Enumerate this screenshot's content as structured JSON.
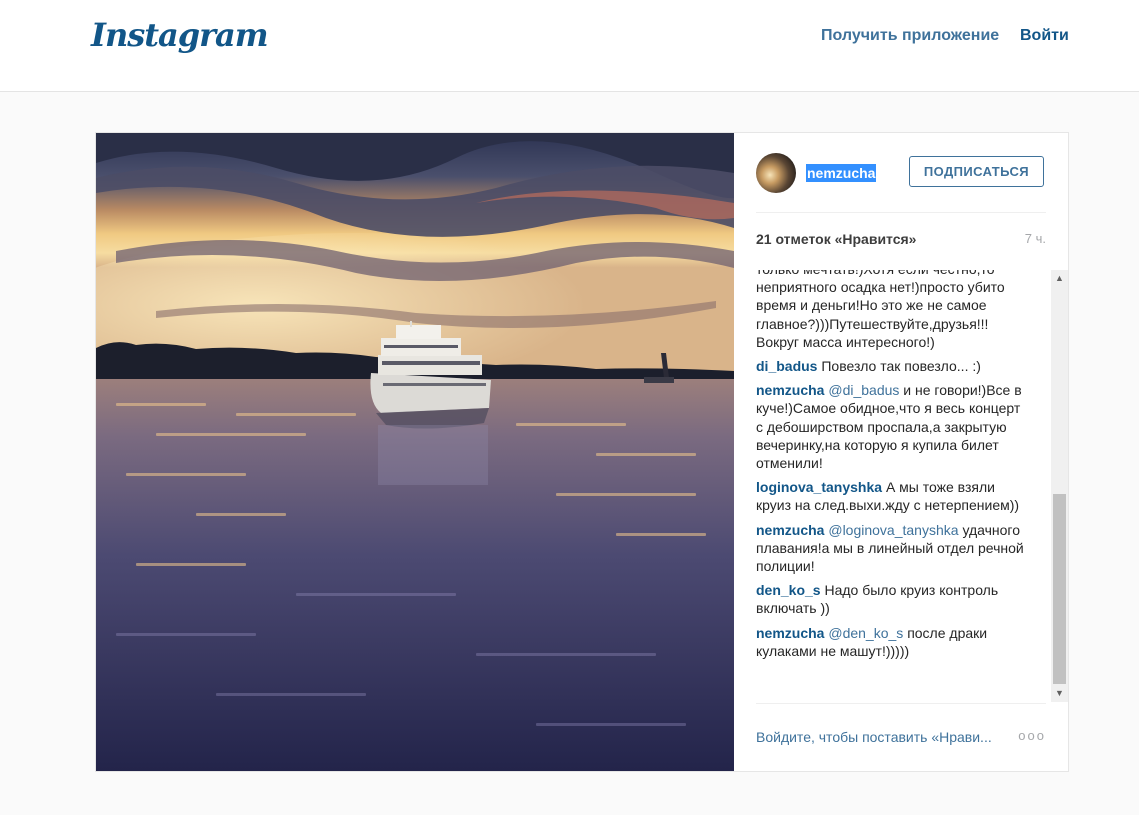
{
  "header": {
    "logo_text": "Instagram",
    "get_app_label": "Получить приложение",
    "login_label": "Войти"
  },
  "post": {
    "author": "nemzucha",
    "follow_label": "ПОДПИСАТЬСЯ",
    "likes_text": "21 отметок «Нравится»",
    "time_ago": "7 ч.",
    "caption_tail": "только мечтать!)Хотя если честно,то неприятного осадка нет!)просто убито время и деньги!Но это же не самое главное?)))Путешествуйте,друзья!!! Вокруг масса интересного!)",
    "comments": [
      {
        "user": "di_badus",
        "mention": "",
        "text": "Повезло так повезло... :)"
      },
      {
        "user": "nemzucha",
        "mention": "@di_badus",
        "text": "и не говори!)Все в куче!)Самое обидное,что я весь концерт с дебоширством проспала,а закрытую вечеринку,на которую я купила билет отменили!"
      },
      {
        "user": "loginova_tanyshka",
        "mention": "",
        "text": "А мы тоже взяли круиз на след.выхи.жду с нетерпением))"
      },
      {
        "user": "nemzucha",
        "mention": "@loginova_tanyshka",
        "text": "удачного плавания!а мы в линейный отдел речной полиции!"
      },
      {
        "user": "den_ko_s",
        "mention": "",
        "text": "Надо было круиз контроль включать ))"
      },
      {
        "user": "nemzucha",
        "mention": "@den_ko_s",
        "text": "после драки кулаками не машут!)))))"
      }
    ],
    "login_prompt_link": "Войдите",
    "login_prompt_rest": ", чтобы поставить «Нрави...",
    "more_label": "ооо"
  },
  "icons": {
    "scroll_up": "scroll-up-arrow-icon",
    "scroll_down": "scroll-down-arrow-icon",
    "more": "more-options-icon"
  },
  "colors": {
    "brand": "#125688",
    "link": "#3f729b",
    "selection": "#3390ff"
  }
}
